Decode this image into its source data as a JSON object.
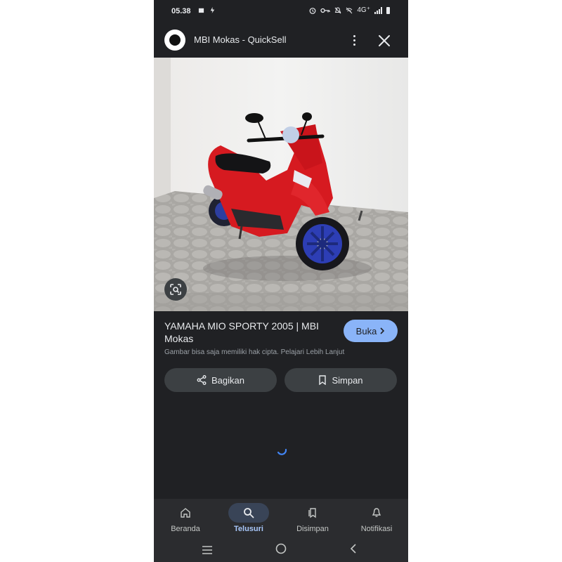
{
  "status_bar": {
    "time": "05.38",
    "network": "4G⁺"
  },
  "header": {
    "title": "MBI Mokas - QuickSell"
  },
  "image": {
    "subject": "red scooter"
  },
  "result": {
    "title": "YAMAHA MIO SPORTY 2005 | MBI Mokas",
    "open_label": "Buka",
    "copyright_text": "Gambar bisa saja memiliki hak cipta.",
    "learn_more": "Pelajari Lebih Lanjut"
  },
  "actions": {
    "share_label": "Bagikan",
    "save_label": "Simpan"
  },
  "bottom_nav": [
    {
      "label": "Beranda",
      "icon": "home-icon"
    },
    {
      "label": "Telusuri",
      "icon": "search-icon",
      "active": true
    },
    {
      "label": "Disimpan",
      "icon": "saved-icon"
    },
    {
      "label": "Notifikasi",
      "icon": "bell-icon"
    }
  ],
  "colors": {
    "background": "#202124",
    "accent": "#8ab4f8",
    "button": "#3c4043"
  }
}
